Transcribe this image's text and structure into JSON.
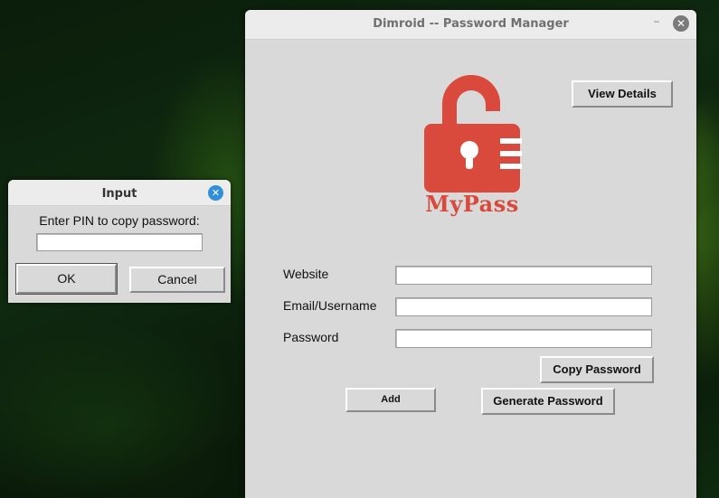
{
  "main_window": {
    "title": "Dimroid -- Password Manager",
    "minimize_glyph": "–",
    "close_glyph": "✕",
    "view_details_label": "View Details",
    "logo_text": "MyPass",
    "website_label": "Website",
    "email_label": "Email/Username",
    "password_label": "Password",
    "website_value": "",
    "email_value": "",
    "password_value": "",
    "copy_password_label": "Copy Password",
    "add_label": "Add",
    "generate_password_label": "Generate Password"
  },
  "dialog": {
    "title": "Input",
    "close_glyph": "✕",
    "prompt": "Enter PIN to copy password:",
    "pin_value": "",
    "ok_label": "OK",
    "cancel_label": "Cancel"
  },
  "colors": {
    "logo_red": "#d94a3c",
    "window_bg": "#d9d9d9",
    "dialog_close_blue": "#2f8fd8"
  }
}
